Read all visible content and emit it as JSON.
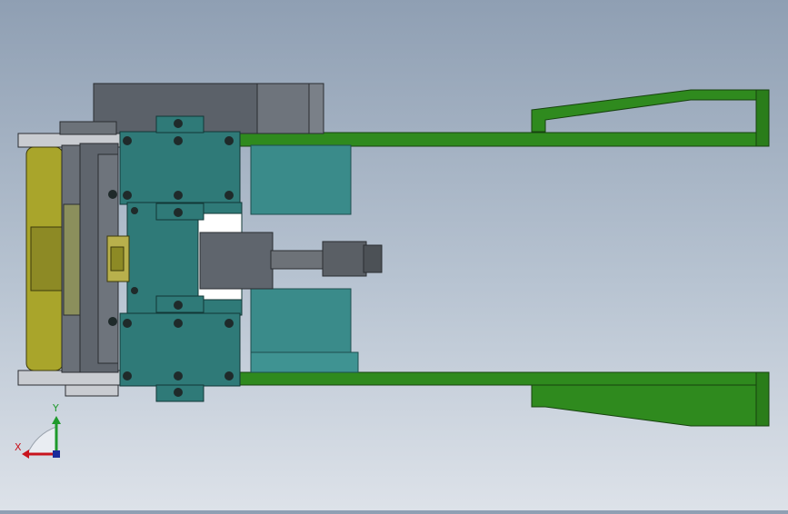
{
  "viewport": {
    "background_top": "#8f9fb3",
    "background_bottom": "#dde2e9"
  },
  "model": {
    "colors": {
      "fork_green": "#2f8a1e",
      "frame_teal": "#2f7a78",
      "motor_teal": "#3a8b8a",
      "dark_gray": "#5b6169",
      "mid_gray": "#7a8088",
      "roller_yellow": "#a9a52b",
      "shaft_gray": "#6d7278"
    }
  },
  "triad": {
    "x_label": "X",
    "y_label": "Y",
    "x_color": "#c8141e",
    "y_color": "#1f9a2c",
    "z_color": "#1a2a9a"
  }
}
